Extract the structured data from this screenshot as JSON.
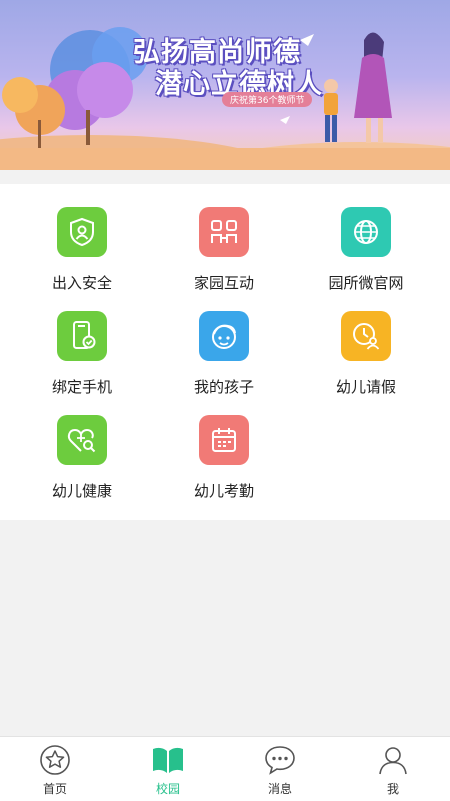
{
  "banner": {
    "title_line1": "弘扬高尚师德",
    "title_line2": "潜心立德树人",
    "subtitle": "庆祝第36个教师节"
  },
  "grid": {
    "items": [
      {
        "label": "出入安全",
        "icon": "shield-person-icon",
        "color": "#6dcc3e"
      },
      {
        "label": "家园互动",
        "icon": "two-people-icon",
        "color": "#f17a76"
      },
      {
        "label": "园所微官网",
        "icon": "globe-icon",
        "color": "#2ec9b2"
      },
      {
        "label": "绑定手机",
        "icon": "phone-check-icon",
        "color": "#6dcc3e"
      },
      {
        "label": "我的孩子",
        "icon": "child-face-icon",
        "color": "#3aa6ea"
      },
      {
        "label": "幼儿请假",
        "icon": "clock-person-icon",
        "color": "#f7b424"
      },
      {
        "label": "幼儿健康",
        "icon": "heart-search-icon",
        "color": "#6dcc3e"
      },
      {
        "label": "幼儿考勤",
        "icon": "calendar-icon",
        "color": "#f17a76"
      }
    ]
  },
  "tabbar": {
    "active_color": "#27c08c",
    "items": [
      {
        "label": "首页",
        "icon": "star-circle-icon"
      },
      {
        "label": "校园",
        "icon": "open-book-icon"
      },
      {
        "label": "消息",
        "icon": "chat-bubble-icon"
      },
      {
        "label": "我",
        "icon": "person-icon"
      }
    ]
  }
}
